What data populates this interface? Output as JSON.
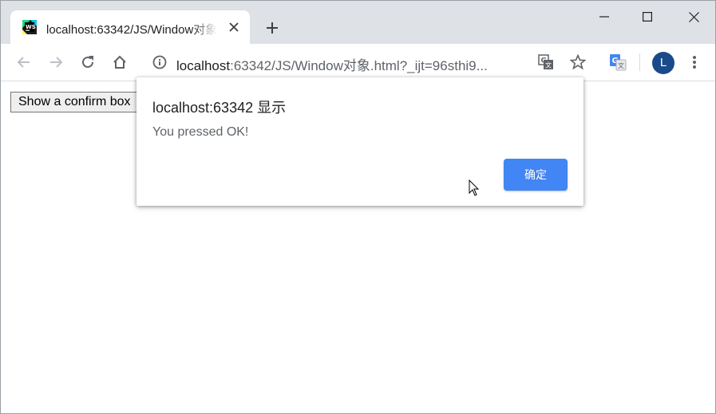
{
  "tab": {
    "title": "localhost:63342/JS/Window对象",
    "favicon": "webstorm-icon"
  },
  "toolbar": {
    "url_host": "localhost",
    "url_rest": ":63342/JS/Window对象.html?_ijt=96sthi9..."
  },
  "profile": {
    "initial": "L",
    "color": "#1a4a8a"
  },
  "page": {
    "button_label": "Show a confirm box"
  },
  "dialog": {
    "title": "localhost:63342 显示",
    "message": "You pressed OK!",
    "ok_label": "确定",
    "accent": "#4285f4"
  },
  "icons": [
    "back-icon",
    "forward-icon",
    "reload-icon",
    "home-icon",
    "info-icon",
    "translate-icon",
    "star-icon",
    "google-translate-extension-icon",
    "menu-icon",
    "close-icon",
    "plus-icon",
    "minimize-icon",
    "maximize-icon",
    "window-close-icon",
    "cursor-icon"
  ]
}
